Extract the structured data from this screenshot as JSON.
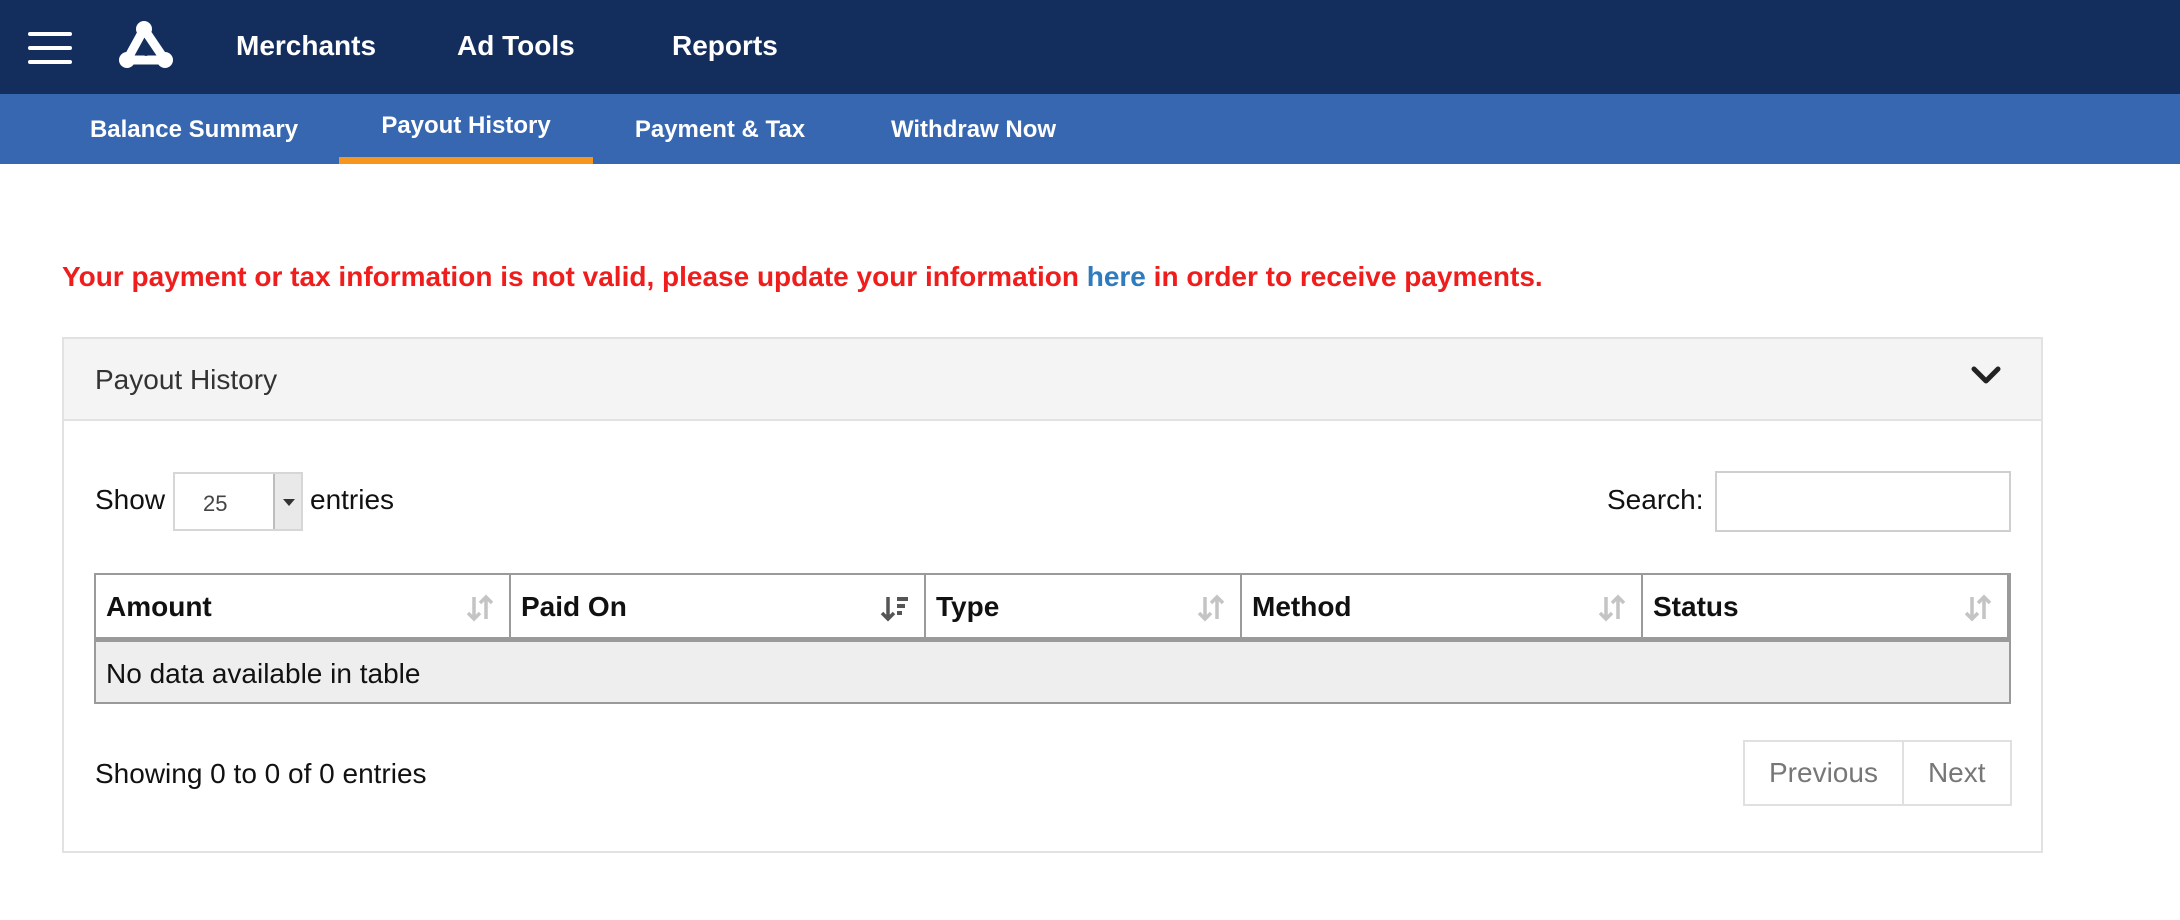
{
  "topnav": {
    "items": [
      {
        "label": "Merchants"
      },
      {
        "label": "Ad Tools"
      },
      {
        "label": "Reports"
      }
    ]
  },
  "subnav": {
    "tabs": [
      {
        "label": "Balance Summary"
      },
      {
        "label": "Payout History",
        "active": true
      },
      {
        "label": "Payment & Tax"
      },
      {
        "label": "Withdraw Now"
      }
    ]
  },
  "alert": {
    "before": "Your payment or tax information is not valid, please update your information ",
    "link": "here",
    "after": " in order to receive payments."
  },
  "panel": {
    "title": "Payout History"
  },
  "length_control": {
    "show_label": "Show",
    "value": "25",
    "entries_label": "entries"
  },
  "search": {
    "label": "Search:",
    "value": ""
  },
  "table": {
    "columns": [
      {
        "label": "Amount",
        "sort": "both"
      },
      {
        "label": "Paid On",
        "sort": "desc"
      },
      {
        "label": "Type",
        "sort": "both"
      },
      {
        "label": "Method",
        "sort": "both"
      },
      {
        "label": "Status",
        "sort": "both"
      }
    ],
    "empty_message": "No data available in table"
  },
  "footer": {
    "info": "Showing 0 to 0 of 0 entries",
    "previous": "Previous",
    "next": "Next"
  },
  "colors": {
    "topbar": "#132e5d",
    "subbar": "#3667b0",
    "active_tab_underline": "#f5961f",
    "alert_text": "#f01d1d",
    "link": "#2f7bbd"
  }
}
